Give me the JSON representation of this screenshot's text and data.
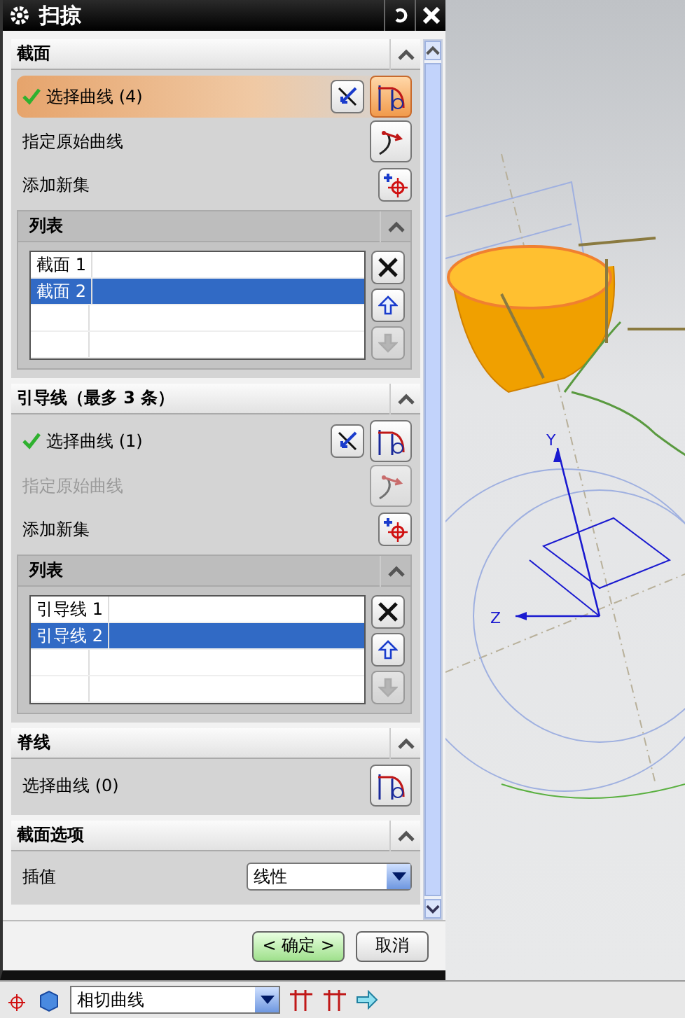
{
  "window": {
    "title": "扫掠"
  },
  "sections": [
    {
      "title": "截面",
      "expanded": true,
      "rows": [
        {
          "kind": "select",
          "label": "选择曲线 (4)",
          "done": true,
          "active": true,
          "reverse": true
        },
        {
          "kind": "origin",
          "label": "指定原始曲线",
          "disabled": false
        },
        {
          "kind": "add",
          "label": "添加新集"
        }
      ],
      "list": {
        "title": "列表",
        "expanded": true,
        "items": [
          {
            "label": "截面 1",
            "selected": false
          },
          {
            "label": "截面 2",
            "selected": true
          }
        ]
      }
    },
    {
      "title": "引导线（最多 3 条）",
      "expanded": true,
      "rows": [
        {
          "kind": "select",
          "label": "选择曲线 (1)",
          "done": true,
          "active": false,
          "reverse": true
        },
        {
          "kind": "origin",
          "label": "指定原始曲线",
          "disabled": true
        },
        {
          "kind": "add",
          "label": "添加新集"
        }
      ],
      "list": {
        "title": "列表",
        "expanded": true,
        "items": [
          {
            "label": "引导线 1",
            "selected": false
          },
          {
            "label": "引导线 2",
            "selected": true
          }
        ]
      }
    },
    {
      "title": "脊线",
      "expanded": true,
      "rows": [
        {
          "kind": "select",
          "label": "选择曲线 (0)",
          "done": false,
          "active": false,
          "reverse": false
        }
      ]
    },
    {
      "title": "截面选项",
      "expanded": true,
      "rows": [
        {
          "kind": "dropdown",
          "label": "插值",
          "value": "线性"
        }
      ]
    }
  ],
  "buttons": [
    {
      "label": "< 确定 >",
      "default": true
    },
    {
      "label": "取消",
      "default": false
    }
  ],
  "viewport": {
    "axis_labels": [
      "Y",
      "Z"
    ]
  },
  "toolbar": {
    "dropdown": "相切曲线"
  }
}
